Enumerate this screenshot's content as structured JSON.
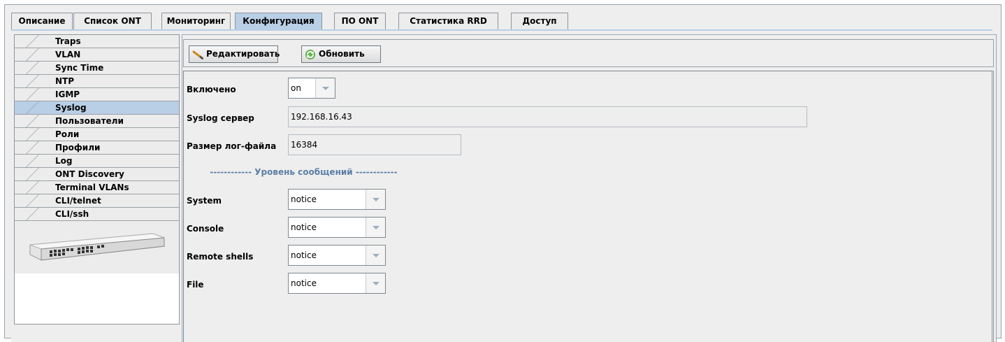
{
  "tabs": [
    {
      "label": "Описание",
      "active": false
    },
    {
      "label": "Список ONT",
      "active": false
    },
    {
      "label": "Мониторинг",
      "active": false
    },
    {
      "label": "Конфигурация",
      "active": true
    },
    {
      "label": "ПО ONT",
      "active": false
    },
    {
      "label": "Статистика RRD",
      "active": false
    },
    {
      "label": "Доступ",
      "active": false
    }
  ],
  "sidebar": {
    "items": [
      {
        "label": "Traps",
        "active": false
      },
      {
        "label": "VLAN",
        "active": false
      },
      {
        "label": "Sync Time",
        "active": false
      },
      {
        "label": "NTP",
        "active": false
      },
      {
        "label": "IGMP",
        "active": false
      },
      {
        "label": "Syslog",
        "active": true
      },
      {
        "label": "Пользователи",
        "active": false
      },
      {
        "label": "Роли",
        "active": false
      },
      {
        "label": "Профили",
        "active": false
      },
      {
        "label": "Log",
        "active": false
      },
      {
        "label": "ONT Discovery",
        "active": false
      },
      {
        "label": "Terminal VLANs",
        "active": false
      },
      {
        "label": "CLI/telnet",
        "active": false
      },
      {
        "label": "CLI/ssh",
        "active": false
      }
    ],
    "device_image": "network-switch-icon"
  },
  "toolbar": {
    "edit_label": "Редактировать",
    "edit_icon": "pencil-icon",
    "refresh_label": "Обновить",
    "refresh_icon": "refresh-icon"
  },
  "form": {
    "enabled_label": "Включено",
    "enabled_value": "on",
    "syslog_server_label": "Syslog сервер",
    "syslog_server_value": "192.168.16.43",
    "log_size_label": "Размер лог-файла",
    "log_size_value": "16384",
    "section_title": "------------ Уровень сообщений ------------",
    "levels": [
      {
        "label": "System",
        "value": "notice"
      },
      {
        "label": "Console",
        "value": "notice"
      },
      {
        "label": "Remote shells",
        "value": "notice"
      },
      {
        "label": "File",
        "value": "notice"
      }
    ]
  },
  "colors": {
    "active_tab": "#b9cfe6",
    "section_title": "#5b7fa6",
    "background": "#eeeeee"
  }
}
